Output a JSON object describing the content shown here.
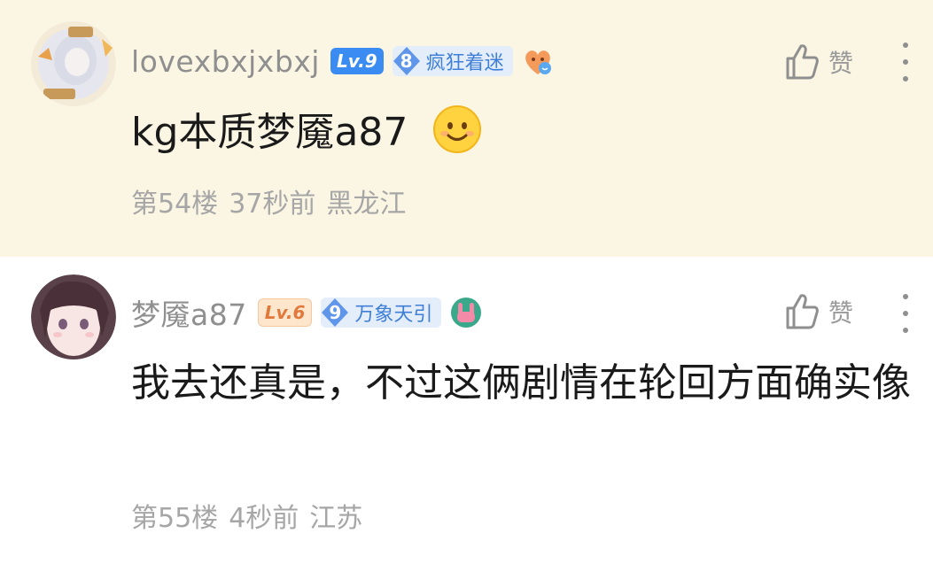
{
  "comments": [
    {
      "username": "lovexbxjxbxj",
      "level_badge": "Lv.9",
      "fan_badge": {
        "level": "8",
        "name": "疯狂着迷"
      },
      "content": "kg本质梦魇a87",
      "floor": "第54楼",
      "time": "37秒前",
      "location": "黑龙江",
      "like_label": "赞"
    },
    {
      "username": "梦魇a87",
      "level_badge": "Lv.6",
      "fan_badge": {
        "level": "9",
        "name": "万象天引"
      },
      "content": "我去还真是，不过这俩剧情在轮回方面确实像",
      "floor": "第55楼",
      "time": "4秒前",
      "location": "江苏",
      "like_label": "赞"
    }
  ],
  "colors": {
    "highlight_bg": "#fbf6e4",
    "lv9_badge": "#3b8cf2",
    "lv6_badge": "#fde6cc",
    "fan_badge_bg": "#e4eefb",
    "fan_badge_text": "#3f7fd8"
  },
  "icons": [
    "avatar-image",
    "fan-level-diamond-icon",
    "heart-face-emoji-icon",
    "smile-emoji-icon",
    "rock-hand-emoji-icon",
    "thumbs-up-icon",
    "more-vertical-icon"
  ]
}
